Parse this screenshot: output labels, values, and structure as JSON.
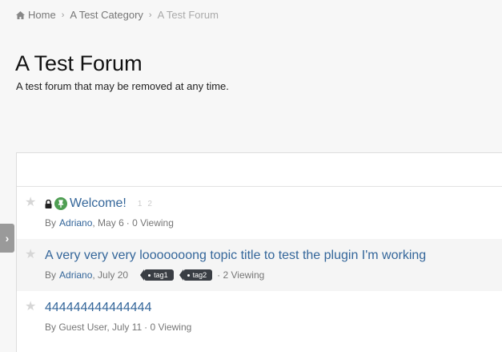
{
  "breadcrumb": {
    "home": "Home",
    "category": "A Test Category",
    "current": "A Test Forum"
  },
  "forum": {
    "title": "A Test Forum",
    "description": "A test forum that may be removed at any time."
  },
  "topics": [
    {
      "title": "Welcome!",
      "pages": [
        "1",
        "2"
      ],
      "by": "By",
      "author": "Adriano",
      "date": ", May 6",
      "viewing": "· 0 Viewing",
      "locked": true,
      "pinned": true
    },
    {
      "title": "A very very very looooooong topic title to test the plugin I'm working",
      "by": "By",
      "author": "Adriano",
      "date": ", July 20",
      "tags": [
        "tag1",
        "tag2"
      ],
      "viewing": "· 2 Viewing"
    },
    {
      "title": "444444444444444",
      "by": "By Guest User, July 11",
      "viewing": "· 0 Viewing"
    }
  ],
  "colors": {
    "link": "#34669a",
    "highlight": "#f6f100",
    "tag_bg": "#3a3e44",
    "pin": "#4f9e53"
  },
  "icons": {
    "home": "home-icon",
    "star": "star-icon",
    "lock": "lock-icon",
    "pin": "pin-icon",
    "tag": "tag-icon",
    "toggle": "chevron-right-icon"
  }
}
